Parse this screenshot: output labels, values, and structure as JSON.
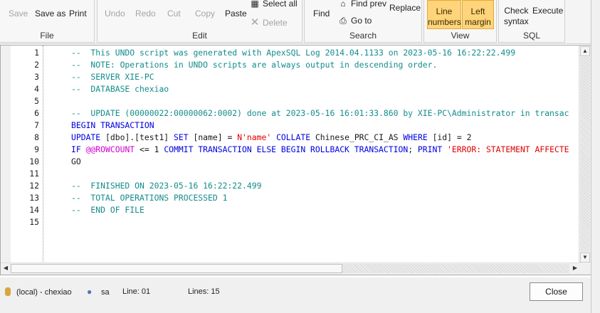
{
  "ribbon": {
    "file": {
      "label": "File",
      "buttons": [
        {
          "label": "Save",
          "icon": "save-icon",
          "enabled": false
        },
        {
          "label": "Save as",
          "icon": "save-as-icon",
          "enabled": true
        },
        {
          "label": "Print",
          "icon": "print-icon",
          "enabled": true
        }
      ]
    },
    "edit": {
      "label": "Edit",
      "undo": "Undo",
      "redo": "Redo",
      "cut": "Cut",
      "copy": "Copy",
      "paste": "Paste",
      "select_all": "Select all",
      "delete": "Delete"
    },
    "search": {
      "label": "Search",
      "find": "Find",
      "find_prev": "Find prev",
      "go_to": "Go to",
      "replace": "Replace"
    },
    "view": {
      "label": "View",
      "line_numbers": [
        "Line",
        "numbers"
      ],
      "left_margin": [
        "Left",
        "margin"
      ]
    },
    "sql": {
      "label": "SQL",
      "check_syntax": [
        "Check",
        "syntax"
      ],
      "execute": "Execute"
    }
  },
  "editor": {
    "lines": [
      {
        "n": "1",
        "tokens": [
          {
            "t": "--  This UNDO script was generated with ApexSQL Log 2014.04.1133 on 2023-05-16 16:22:22.499",
            "c": "comment"
          }
        ]
      },
      {
        "n": "2",
        "tokens": [
          {
            "t": "--  NOTE: Operations in UNDO scripts are always output in descending order.",
            "c": "comment"
          }
        ]
      },
      {
        "n": "3",
        "tokens": [
          {
            "t": "--  SERVER XIE-PC",
            "c": "comment"
          }
        ]
      },
      {
        "n": "4",
        "tokens": [
          {
            "t": "--  DATABASE chexiao",
            "c": "comment"
          }
        ]
      },
      {
        "n": "5",
        "tokens": []
      },
      {
        "n": "6",
        "tokens": [
          {
            "t": "--  UPDATE (00000022:00000062:0002) done at 2023-05-16 16:01:33.860 by XIE-PC\\Administrator in transac",
            "c": "comment"
          }
        ]
      },
      {
        "n": "7",
        "tokens": [
          {
            "t": "BEGIN TRANSACTION",
            "c": "kw"
          }
        ]
      },
      {
        "n": "8",
        "tokens": [
          {
            "t": "UPDATE ",
            "c": "kw"
          },
          {
            "t": "[dbo].[test1] ",
            "c": "txt"
          },
          {
            "t": "SET ",
            "c": "kw"
          },
          {
            "t": "[name] = ",
            "c": "txt"
          },
          {
            "t": "N'name' ",
            "c": "str"
          },
          {
            "t": "COLLATE ",
            "c": "kw"
          },
          {
            "t": "Chinese_PRC_CI_AS ",
            "c": "txt"
          },
          {
            "t": "WHERE ",
            "c": "kw"
          },
          {
            "t": "[id] = 2",
            "c": "txt"
          }
        ]
      },
      {
        "n": "9",
        "tokens": [
          {
            "t": "IF ",
            "c": "kw"
          },
          {
            "t": "@@ROWCOUNT ",
            "c": "var"
          },
          {
            "t": "<= 1 ",
            "c": "txt"
          },
          {
            "t": "COMMIT TRANSACTION ELSE BEGIN ROLLBACK TRANSACTION",
            "c": "kw"
          },
          {
            "t": "; ",
            "c": "txt"
          },
          {
            "t": "PRINT ",
            "c": "kw"
          },
          {
            "t": "'ERROR: STATEMENT AFFECTE",
            "c": "str"
          }
        ]
      },
      {
        "n": "10",
        "tokens": [
          {
            "t": "GO",
            "c": "txt"
          }
        ]
      },
      {
        "n": "11",
        "tokens": []
      },
      {
        "n": "12",
        "tokens": [
          {
            "t": "--  FINISHED ON 2023-05-16 16:22:22.499",
            "c": "comment"
          }
        ]
      },
      {
        "n": "13",
        "tokens": [
          {
            "t": "--  TOTAL OPERATIONS PROCESSED 1",
            "c": "comment"
          }
        ]
      },
      {
        "n": "14",
        "tokens": [
          {
            "t": "--  END OF FILE",
            "c": "comment"
          }
        ]
      },
      {
        "n": "15",
        "tokens": []
      }
    ]
  },
  "status": {
    "server": "(local) - chexiao",
    "user": "sa",
    "line": "Line: 01",
    "lines": "Lines: 15",
    "close_label": "Close"
  },
  "colors": {
    "comment": "#148c8c",
    "keyword": "#0000e0",
    "string": "#e00000",
    "variable": "#d000d0",
    "toggle_active": "#ffd47a"
  }
}
